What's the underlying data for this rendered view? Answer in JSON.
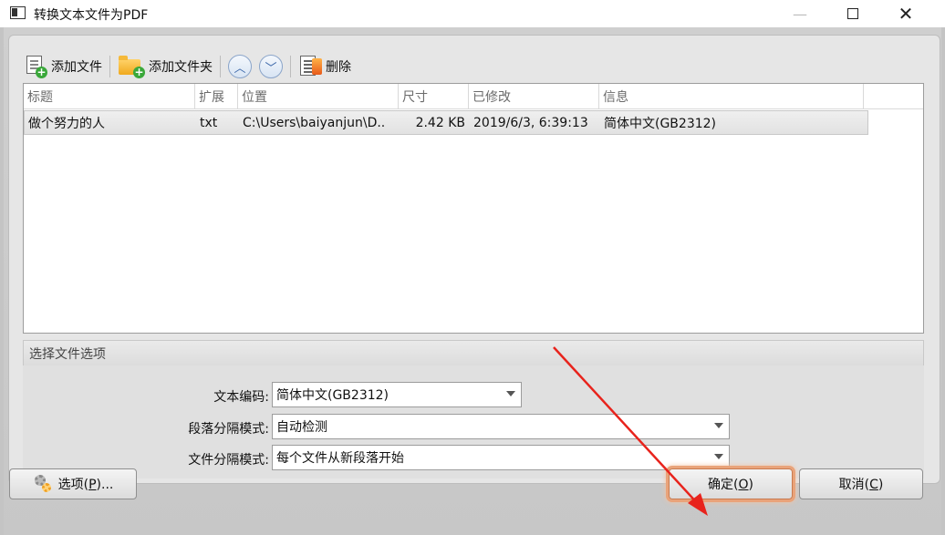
{
  "window": {
    "title": "转换文本文件为PDF",
    "minimize_glyph": "—",
    "close_glyph": "✕"
  },
  "toolbar": {
    "add_file": "添加文件",
    "add_folder": "添加文件夹",
    "up_glyph": "︿",
    "down_glyph": "﹀",
    "delete": "删除"
  },
  "file_list": {
    "columns": [
      "标题",
      "扩展",
      "位置",
      "尺寸",
      "已修改",
      "信息"
    ],
    "rows": [
      {
        "title": "做个努力的人",
        "ext": "txt",
        "location": "C:\\Users\\baiyanjun\\D..",
        "size": "2.42 KB",
        "modified": "2019/6/3, 6:39:13",
        "info": "简体中文(GB2312)"
      }
    ]
  },
  "options": {
    "section_title": "选择文件选项",
    "encoding_label": "文本编码:",
    "encoding_value": "简体中文(GB2312)",
    "paragraph_label": "段落分隔模式:",
    "paragraph_value": "自动检测",
    "file_sep_label": "文件分隔模式:",
    "file_sep_value": "每个文件从新段落开始"
  },
  "buttons": {
    "options_prefix": "选项(",
    "options_key": "P",
    "options_suffix": ")...",
    "ok_prefix": "确定(",
    "ok_key": "O",
    "ok_suffix": ")",
    "cancel_prefix": "取消(",
    "cancel_key": "C",
    "cancel_suffix": ")"
  },
  "colors": {
    "annotation_arrow": "#e8231c",
    "ok_highlight": "#e9a37a"
  }
}
